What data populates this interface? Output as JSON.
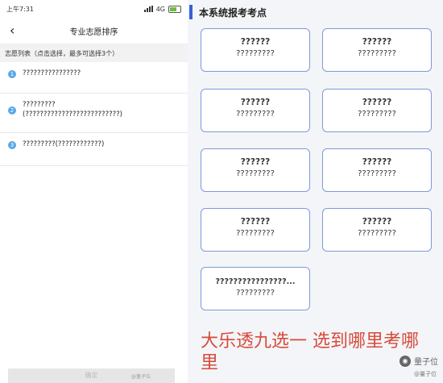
{
  "left": {
    "status": {
      "time": "上午7:31",
      "network": "4G"
    },
    "nav": {
      "title": "专业志愿排序"
    },
    "section_header": "志愿列表（点击选择，最多可选择3个）",
    "items": [
      {
        "num": "1",
        "text": "????????????????"
      },
      {
        "num": "2",
        "text": "?????????\n(??????????????????????????)"
      },
      {
        "num": "3",
        "text": "?????????(????????????)"
      }
    ],
    "confirm_label": "确定",
    "watermark": "@量子位"
  },
  "right": {
    "title": "本系统报考考点",
    "cards": [
      {
        "l1": "??????",
        "l2": "?????????"
      },
      {
        "l1": "??????",
        "l2": "?????????"
      },
      {
        "l1": "??????",
        "l2": "?????????"
      },
      {
        "l1": "??????",
        "l2": "?????????"
      },
      {
        "l1": "??????",
        "l2": "?????????"
      },
      {
        "l1": "??????",
        "l2": "?????????"
      },
      {
        "l1": "??????",
        "l2": "?????????"
      },
      {
        "l1": "??????",
        "l2": "?????????"
      },
      {
        "l1": "????????????????...",
        "l2": "?????????"
      }
    ],
    "big_text": "大乐透九选一 选到哪里考哪里",
    "watermark": "量子位",
    "watermark_small": "@量子位"
  },
  "colors": {
    "accent": "#3a5fd6",
    "card_border": "#7f9ad9",
    "red_text": "#d84a3a",
    "num_badge": "#5aa8e6"
  }
}
